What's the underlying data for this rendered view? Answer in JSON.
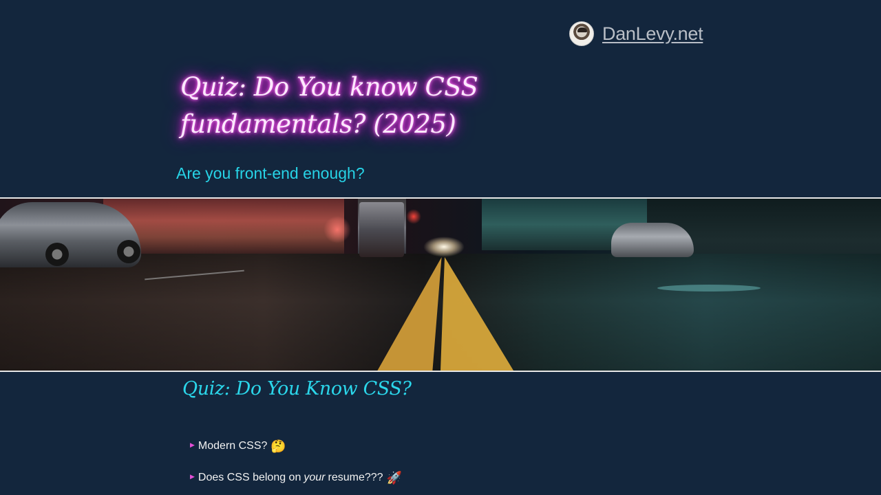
{
  "header": {
    "site_name": "DanLevy.net",
    "avatar_icon": "avatar-icon"
  },
  "hero": {
    "title": "Quiz: Do You know CSS fundamentals? (2025)",
    "subtitle": "Are you front-end enough?",
    "title_glow_color": "#ff2fe8",
    "subtitle_color": "#27d3e6"
  },
  "banner": {
    "alt": "Night city street with yellow road lines"
  },
  "section": {
    "title": "Quiz: Do You Know CSS?"
  },
  "bullets": [
    {
      "text": "Modern CSS?",
      "emoji": "🤔"
    },
    {
      "text_before": "Does CSS belong on",
      "text_emphasis": "your",
      "text_after": "resume???",
      "emoji": "🚀"
    }
  ],
  "colors": {
    "background": "#13263d",
    "accent_cyan": "#27d3e6",
    "accent_magenta": "#e24fd6",
    "link_gray": "#b9bec6"
  }
}
